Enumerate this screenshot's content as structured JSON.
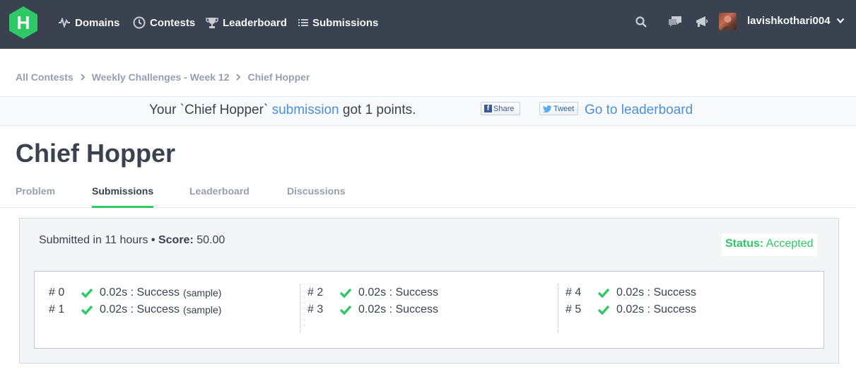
{
  "nav": {
    "logo_letter": "H",
    "links": [
      {
        "label": "Domains",
        "icon": "pulse-icon"
      },
      {
        "label": "Contests",
        "icon": "clock-icon"
      },
      {
        "label": "Leaderboard",
        "icon": "trophy-icon"
      },
      {
        "label": "Submissions",
        "icon": "list-icon"
      }
    ],
    "username": "lavishkothari004"
  },
  "breadcrumb": [
    "All Contests",
    "Weekly Challenges - Week 12",
    "Chief Hopper"
  ],
  "banner": {
    "prefix": "Your `Chief Hopper`",
    "link": "submission",
    "suffix": "got 1 points.",
    "share_label": "Share",
    "tweet_label": "Tweet",
    "leaderboard_link": "Go to leaderboard"
  },
  "page_title": "Chief Hopper",
  "tabs": [
    "Problem",
    "Submissions",
    "Leaderboard",
    "Discussions"
  ],
  "active_tab": "Submissions",
  "submission": {
    "submitted_text": "Submitted in 11 hours",
    "score_label": "Score:",
    "score_value": "50.00",
    "status_label": "Status:",
    "status_value": "Accepted",
    "testcases": [
      {
        "num": "# 0",
        "result": "0.02s : Success",
        "note": "(sample)"
      },
      {
        "num": "# 1",
        "result": "0.02s : Success",
        "note": "(sample)"
      },
      {
        "num": "# 2",
        "result": "0.02s : Success",
        "note": ""
      },
      {
        "num": "# 3",
        "result": "0.02s : Success",
        "note": ""
      },
      {
        "num": "# 4",
        "result": "0.02s : Success",
        "note": ""
      },
      {
        "num": "# 5",
        "result": "0.02s : Success",
        "note": ""
      }
    ]
  },
  "colors": {
    "nav_bg": "#39424e",
    "brand_green": "#2ec866",
    "link_blue": "#4a90d9",
    "muted": "#979faf"
  }
}
